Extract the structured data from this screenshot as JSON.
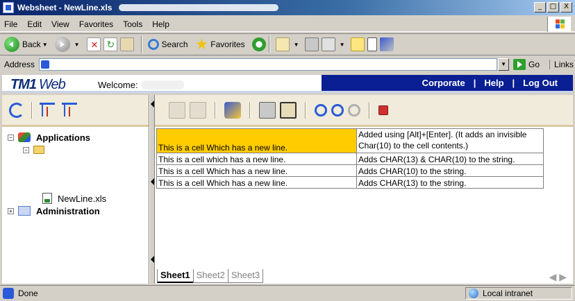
{
  "window": {
    "title": "Websheet - NewLine.xls",
    "minimize": "_",
    "maximize": "□",
    "close": "X"
  },
  "menu": {
    "file": "File",
    "edit": "Edit",
    "view": "View",
    "favorites": "Favorites",
    "tools": "Tools",
    "help": "Help"
  },
  "toolbar": {
    "back": "Back",
    "search": "Search",
    "favorites": "Favorites"
  },
  "address": {
    "label": "Address",
    "go": "Go",
    "links": "Links"
  },
  "tm1": {
    "logo": "TM1",
    "logo_web": "Web",
    "welcome": "Welcome:",
    "nav": {
      "corporate": "Corporate",
      "separator": "|",
      "help": "Help",
      "logout": "Log Out"
    }
  },
  "tree": {
    "applications": "Applications",
    "file": "NewLine.xls",
    "administration": "Administration"
  },
  "sheet": {
    "rows": [
      {
        "cell_a": "This is a cell Which has a new line.",
        "cell_b": "Added using [Alt]+[Enter]. (It adds an invisible Char(10) to the cell contents.)"
      },
      {
        "cell_a": "This is a cell which has a new line.",
        "cell_b": "Adds CHAR(13) & CHAR(10) to the string."
      },
      {
        "cell_a": "This is a cell Which has a new line.",
        "cell_b": "Adds CHAR(10) to the string."
      },
      {
        "cell_a": "This is a cell Which has a new line.",
        "cell_b": "Adds CHAR(13) to the string."
      }
    ],
    "highlight_color": "#ffcc00",
    "tabs": [
      "Sheet1",
      "Sheet2",
      "Sheet3"
    ],
    "active_tab": "Sheet1"
  },
  "status": {
    "text": "Done",
    "zone": "Local intranet"
  },
  "colors": {
    "nav_blue": "#0a1f94",
    "titlebar": "#0a246a",
    "logo_blue": "#0d2c7a"
  }
}
